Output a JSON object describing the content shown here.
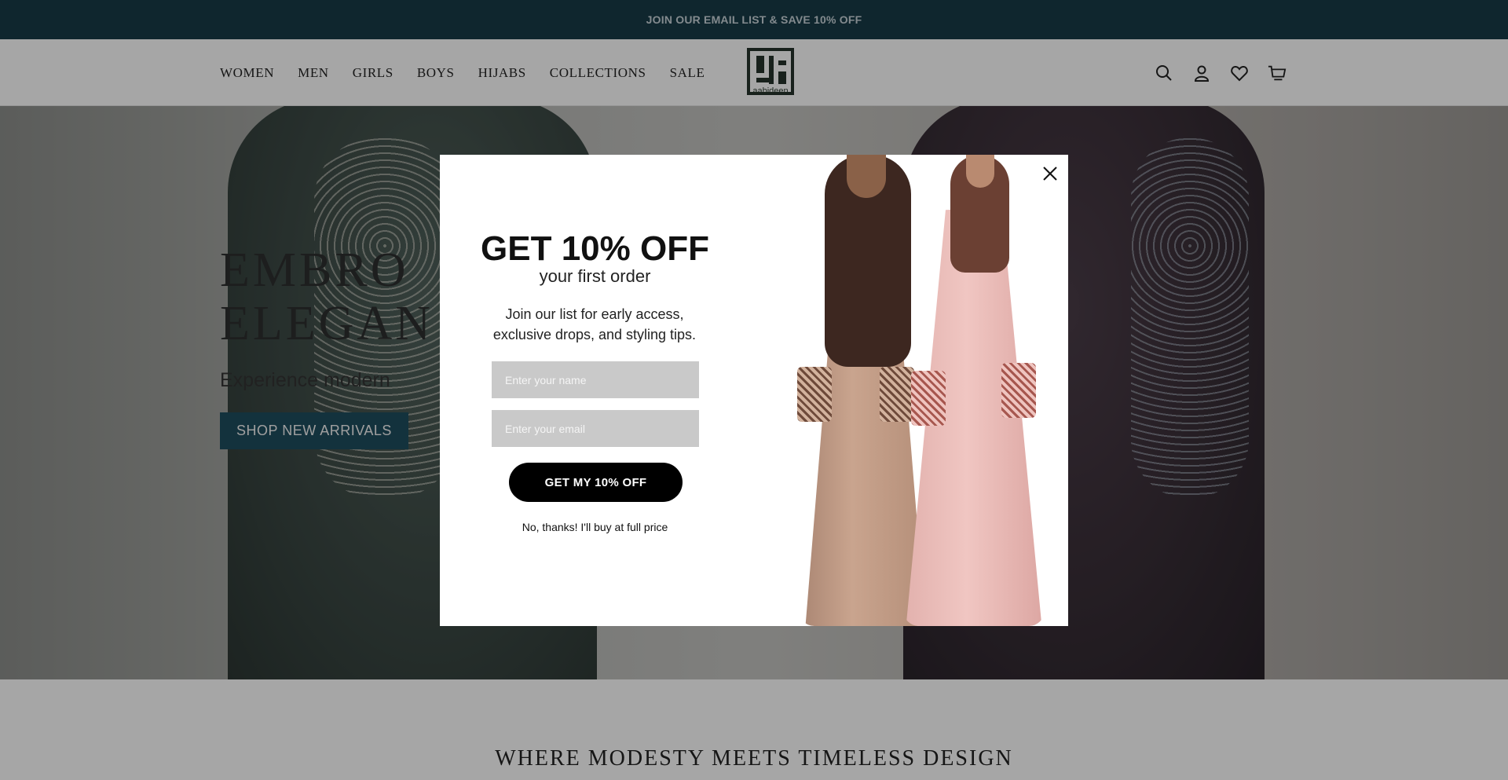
{
  "announcement": {
    "text": "JOIN OUR EMAIL LIST & SAVE 10% OFF"
  },
  "nav": {
    "items": [
      {
        "label": "WOMEN"
      },
      {
        "label": "MEN"
      },
      {
        "label": "GIRLS"
      },
      {
        "label": "BOYS"
      },
      {
        "label": "HIJABS"
      },
      {
        "label": "COLLECTIONS"
      },
      {
        "label": "SALE"
      }
    ]
  },
  "logo": {
    "text": "aabideen"
  },
  "header_icons": [
    "search-icon",
    "account-icon",
    "wishlist-icon",
    "cart-icon"
  ],
  "hero": {
    "title_line1": "EMBRO",
    "title_line2": "ELEGAN",
    "subtitle": "Experience modern",
    "cta_label": "SHOP NEW ARRIVALS"
  },
  "section": {
    "title": "WHERE MODESTY MEETS TIMELESS DESIGN"
  },
  "popup": {
    "title": "GET 10% OFF",
    "subtitle": "your first order",
    "description": "Join our list for early access, exclusive drops, and styling tips.",
    "name_placeholder": "Enter your name",
    "email_placeholder": "Enter your email",
    "submit_label": "GET MY 10% OFF",
    "decline_label": "No, thanks! I'll buy at full price"
  },
  "colors": {
    "announcement_bg": "#173b48",
    "cta_bg": "#1e4d5e",
    "popup_button_bg": "#000000",
    "input_bg": "#c9c9c9"
  }
}
